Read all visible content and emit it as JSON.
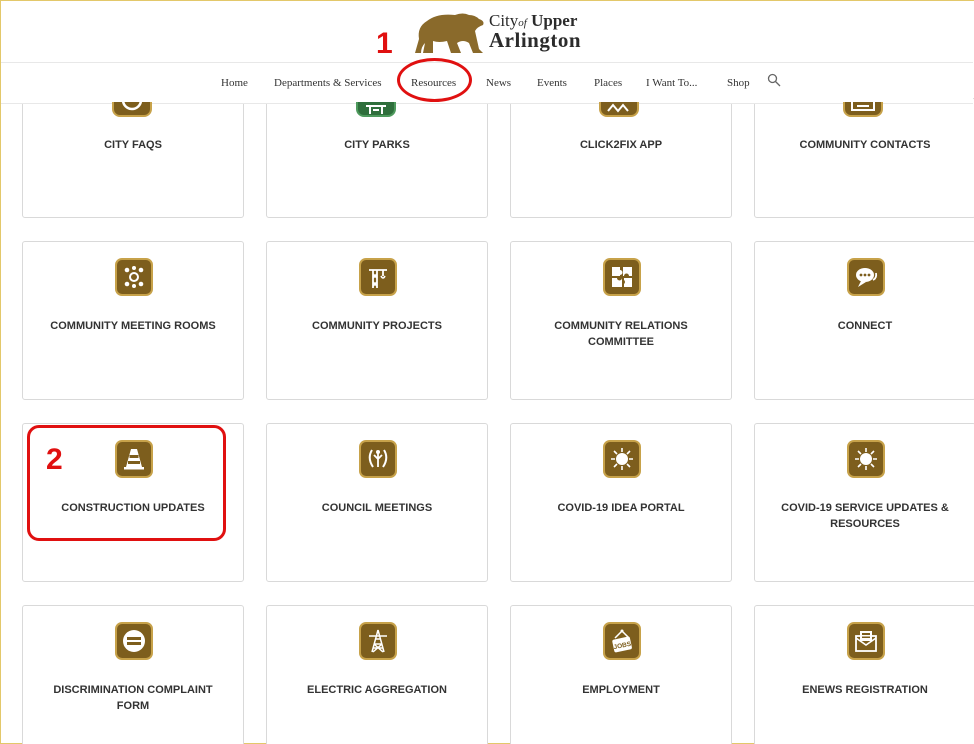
{
  "header": {
    "logo": {
      "line1_prefix": "City",
      "line1_of": "of",
      "line1_main": "Upper",
      "line2": "Arlington"
    },
    "nav": [
      {
        "label": "Home",
        "name": "nav-home"
      },
      {
        "label": "Departments & Services",
        "name": "nav-departments-services"
      },
      {
        "label": "Resources",
        "name": "nav-resources"
      },
      {
        "label": "News",
        "name": "nav-news"
      },
      {
        "label": "Events",
        "name": "nav-events"
      },
      {
        "label": "Places",
        "name": "nav-places"
      },
      {
        "label": "I Want To...",
        "name": "nav-i-want-to"
      },
      {
        "label": "Shop",
        "name": "nav-shop"
      }
    ]
  },
  "annotations": {
    "step1": "1",
    "step2": "2"
  },
  "cards": [
    {
      "label": "CITY FAQS",
      "icon": "faq-icon"
    },
    {
      "label": "CITY PARKS",
      "icon": "park-icon"
    },
    {
      "label": "CLICK2FIX APP",
      "icon": "app-icon"
    },
    {
      "label": "COMMUNITY CONTACTS",
      "icon": "contacts-icon"
    },
    {
      "label": "COMMUNITY MEETING ROOMS",
      "icon": "meeting-room-icon"
    },
    {
      "label": "COMMUNITY PROJECTS",
      "icon": "crane-icon"
    },
    {
      "label": "COMMUNITY RELATIONS COMMITTEE",
      "icon": "puzzle-icon"
    },
    {
      "label": "CONNECT",
      "icon": "chat-icon"
    },
    {
      "label": "CONSTRUCTION UPDATES",
      "icon": "traffic-cone-icon"
    },
    {
      "label": "COUNCIL MEETINGS",
      "icon": "laurel-icon"
    },
    {
      "label": "COVID-19 IDEA PORTAL",
      "icon": "virus-icon"
    },
    {
      "label": "COVID-19 SERVICE UPDATES & RESOURCES",
      "icon": "virus-icon"
    },
    {
      "label": "DISCRIMINATION COMPLAINT FORM",
      "icon": "equals-icon"
    },
    {
      "label": "ELECTRIC AGGREGATION",
      "icon": "power-tower-icon"
    },
    {
      "label": "EMPLOYMENT",
      "icon": "jobs-sign-icon"
    },
    {
      "label": "ENEWS REGISTRATION",
      "icon": "envelope-icon"
    }
  ],
  "colors": {
    "icon_brown": "#7d5e1d",
    "icon_green": "#2f6f3c",
    "annotation_red": "#e01010"
  }
}
